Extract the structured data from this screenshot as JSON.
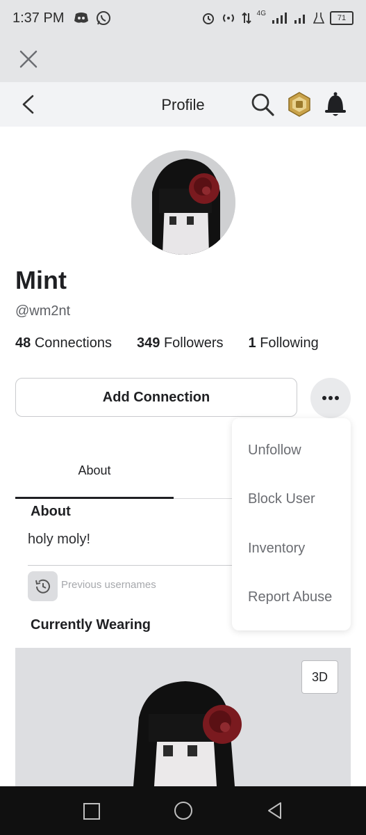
{
  "status_bar": {
    "time": "1:37 PM",
    "network": "4G",
    "battery": "71",
    "icons": [
      "discord-icon",
      "whatsapp-icon",
      "alarm-icon",
      "hotspot-icon",
      "data-arrows-icon",
      "signal-icon",
      "signal-icon",
      "lab-icon",
      "battery-icon"
    ]
  },
  "header": {
    "title": "Profile",
    "icons": [
      "back-icon",
      "search-icon",
      "robux-icon",
      "bell-icon"
    ]
  },
  "profile": {
    "display_name": "Mint",
    "username": "@wm2nt",
    "stats": [
      {
        "count": "48",
        "label": "Connections"
      },
      {
        "count": "349",
        "label": "Followers"
      },
      {
        "count": "1",
        "label": "Following"
      }
    ]
  },
  "actions": {
    "add_connection": "Add Connection",
    "more_icon": "more-dots-icon"
  },
  "menu": {
    "items": [
      "Unfollow",
      "Block User",
      "Inventory",
      "Report Abuse"
    ]
  },
  "tabs": [
    {
      "label": "About",
      "active": true
    }
  ],
  "about": {
    "title": "About",
    "text": "holy moly!",
    "previous_usernames": "Previous usernames"
  },
  "wearing": {
    "title": "Currently Wearing",
    "view_toggle": "3D"
  },
  "colors": {
    "header_bg": "#f2f3f5",
    "robux_gold": "#c9a24a",
    "rose": "#7a1a1f"
  }
}
